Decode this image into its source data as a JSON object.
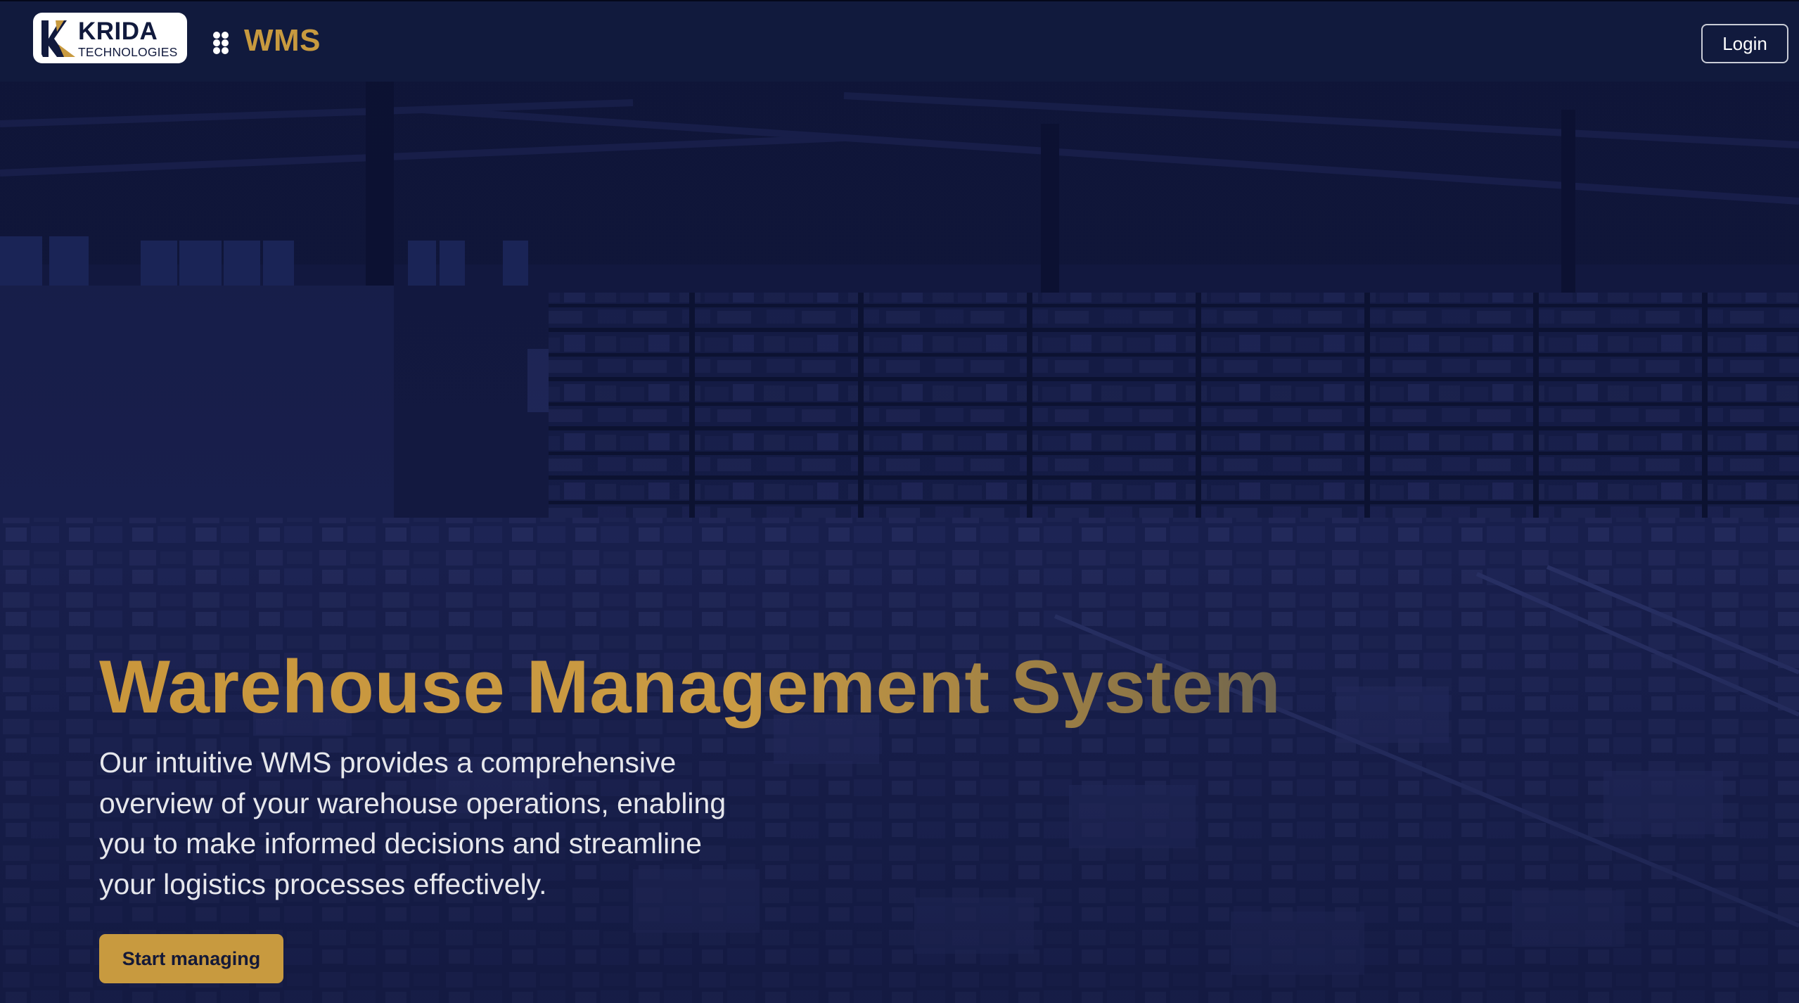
{
  "brand": {
    "logo_line1": "KRIDA",
    "logo_line2": "TECHNOLOGIES",
    "app_name": "WMS",
    "menu_icon": "grid-dots-icon"
  },
  "nav": {
    "login_label": "Login"
  },
  "hero": {
    "title": "Warehouse Management System",
    "description": "Our intuitive WMS provides a comprehensive overview of your warehouse operations, enabling you to make informed decisions and streamline your logistics processes effectively.",
    "cta_label": "Start managing",
    "background": "warehouse-photo"
  },
  "colors": {
    "navbar": "#111a3d",
    "gold_accent": "#c89a3f",
    "hero_overlay": "#141b44",
    "text_light": "#e6e7ec"
  }
}
